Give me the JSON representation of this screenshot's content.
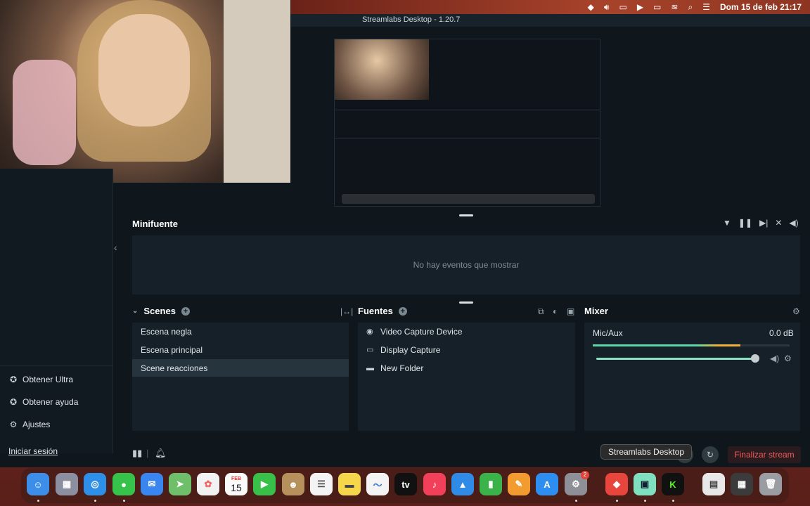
{
  "menubar": {
    "date_time": "Dom 15 de feb  21:17",
    "icons": [
      "notification-icon",
      "volume-icon",
      "screen-mirror-icon",
      "play-icon",
      "battery-icon",
      "wifi-icon",
      "search-icon",
      "control-center-icon"
    ]
  },
  "window": {
    "title": "Streamlabs Desktop - 1.20.7"
  },
  "sidebar": {
    "items": [
      {
        "label": "Obtener Ultra",
        "icon": "ultra-icon"
      },
      {
        "label": "Obtener ayuda",
        "icon": "help-icon"
      },
      {
        "label": "Ajustes",
        "icon": "gear-icon"
      }
    ],
    "login": "Iniciar sesión"
  },
  "minifuente": {
    "title": "Minifuente",
    "empty_text": "No hay eventos que mostrar",
    "icons": [
      "filter-icon",
      "pause-icon",
      "skip-icon",
      "mute-icon",
      "volume-icon"
    ]
  },
  "scenes": {
    "title": "Scenes",
    "items": [
      "Escena negla",
      "Escena principal",
      "Scene reacciones"
    ],
    "selected_index": 2
  },
  "sources": {
    "title": "Fuentes",
    "items": [
      {
        "label": "Video Capture Device",
        "icon": "camera-icon"
      },
      {
        "label": "Display Capture",
        "icon": "monitor-icon"
      },
      {
        "label": "New Folder",
        "icon": "folder-icon"
      }
    ]
  },
  "mixer": {
    "title": "Mixer",
    "channel": "Mic/Aux",
    "db": "0.0 dB",
    "meter_level": 0.75,
    "volume_level": 0.98
  },
  "footer": {
    "end_stream": "Finalizar stream",
    "tooltip": "Streamlabs Desktop"
  },
  "dock": {
    "calendar_month": "FEB",
    "calendar_day": "15",
    "apple_tv": "tv",
    "settings_badge": "2",
    "items": [
      "finder",
      "launchpad",
      "safari",
      "messages",
      "mail",
      "maps",
      "photos",
      "calendar",
      "facetime",
      "contacts",
      "reminders",
      "notes",
      "freeform",
      "apple-tv",
      "music",
      "keynote",
      "numbers",
      "pages",
      "app-store",
      "system-settings",
      "anydesk",
      "streamlabs",
      "kick",
      "document",
      "screenshot",
      "trash"
    ]
  },
  "colors": {
    "accent": "#5fd6a8",
    "danger": "#f05b5b",
    "panel": "#162028",
    "background": "#0f171d"
  }
}
